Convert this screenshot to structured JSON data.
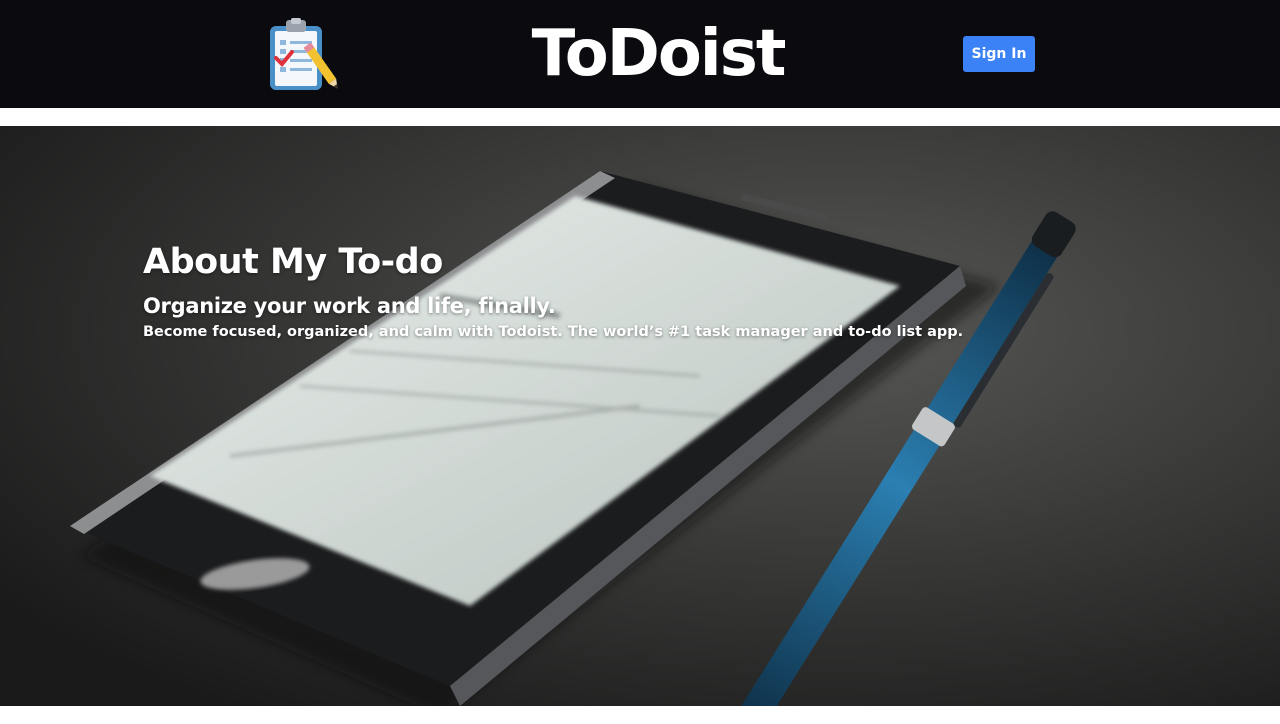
{
  "navbar": {
    "logo_icon": "clipboard-checklist-icon",
    "brand": "ToDoist",
    "signin_label": "Sign In",
    "signin_color": "#3b82f6",
    "background": "#0b0b0f"
  },
  "hero": {
    "title": "About My To-do",
    "subtitle": "Organize your work and life, finally.",
    "description": "Become focused, organized, and calm with Todoist. The world’s #1 task manager and to-do list app.",
    "background_image": "phone-and-pen-photo"
  }
}
